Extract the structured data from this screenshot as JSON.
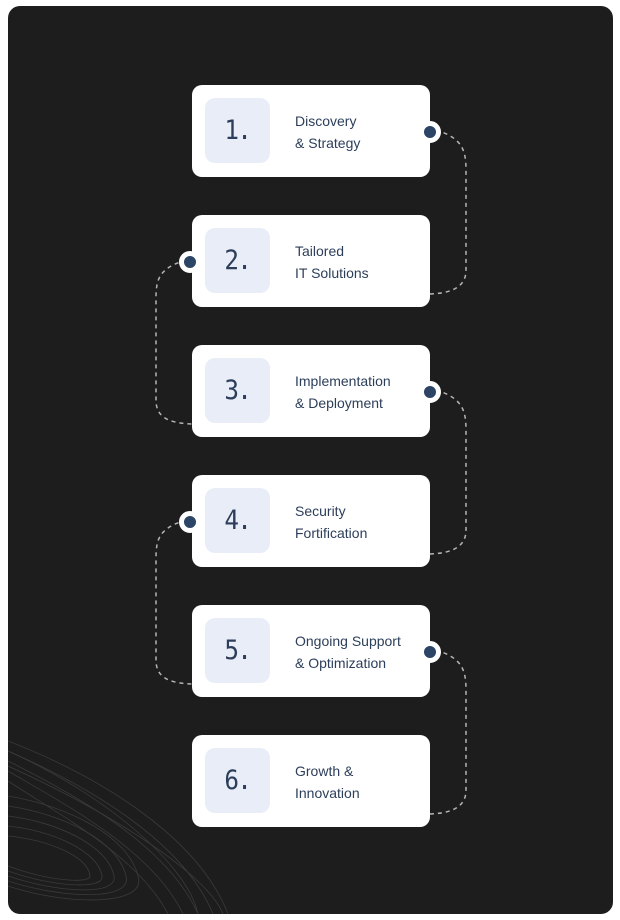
{
  "diagram": {
    "type": "process-flow",
    "colors": {
      "background": "#1d1d1d",
      "card": "#ffffff",
      "number_box": "#e8edf8",
      "text": "#2c3e5a",
      "dot": "#2c4466",
      "connector": "#b5b5b5"
    },
    "steps": [
      {
        "number": "1.",
        "line1": "Discovery",
        "line2": "& Strategy"
      },
      {
        "number": "2.",
        "line1": "Tailored",
        "line2": "IT Solutions"
      },
      {
        "number": "3.",
        "line1": "Implementation",
        "line2": "& Deployment"
      },
      {
        "number": "4.",
        "line1": "Security",
        "line2": "Fortification"
      },
      {
        "number": "5.",
        "line1": "Ongoing Support",
        "line2": "& Optimization"
      },
      {
        "number": "6.",
        "line1": "Growth &",
        "line2": "Innovation"
      }
    ]
  }
}
